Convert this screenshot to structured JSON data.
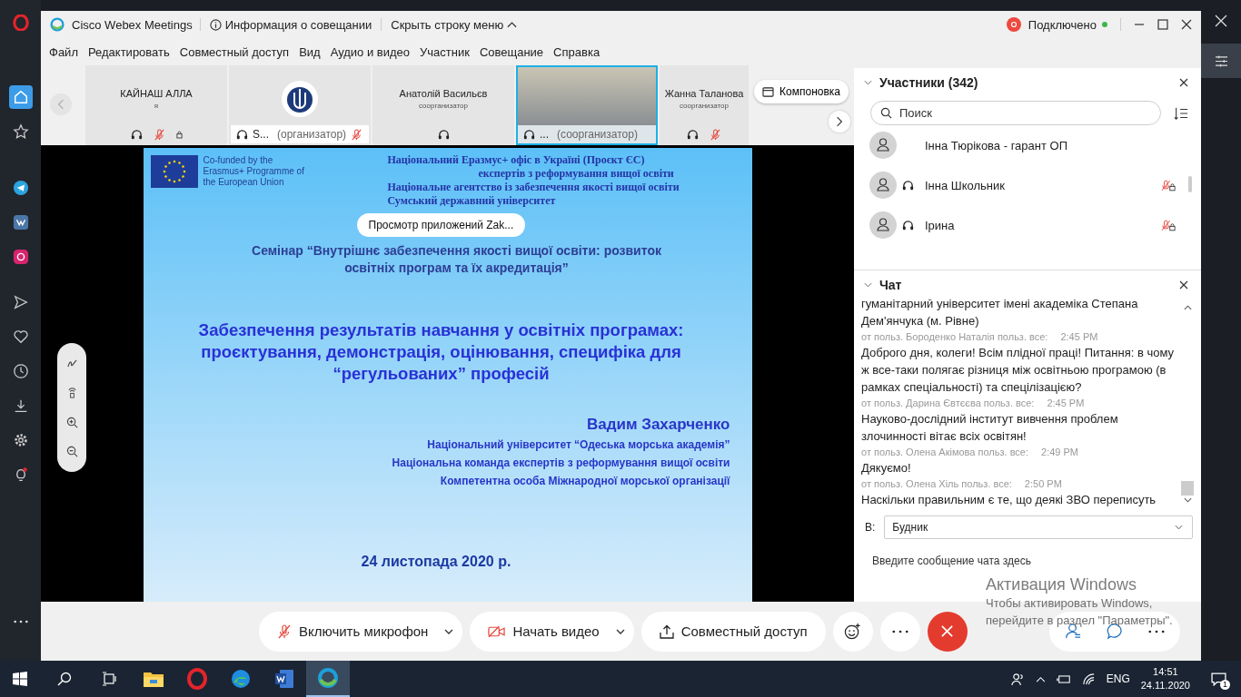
{
  "opera_sidebar": {
    "items": [
      {
        "kind": "home",
        "selected": true
      },
      {
        "kind": "star",
        "selected": false
      },
      {
        "kind": "telegram",
        "selected": false
      },
      {
        "kind": "vk",
        "selected": false
      },
      {
        "kind": "instagram",
        "selected": false
      },
      {
        "kind": "send",
        "selected": false
      },
      {
        "kind": "heart",
        "selected": false
      },
      {
        "kind": "history",
        "selected": false
      },
      {
        "kind": "download",
        "selected": false
      },
      {
        "kind": "settings",
        "selected": false
      },
      {
        "kind": "bulb",
        "selected": false
      }
    ]
  },
  "title_bar": {
    "app_name": "Cisco Webex Meetings",
    "info": "Информация о совещании",
    "hide_menu": "Скрыть строку меню",
    "status": "Подключено",
    "connected": true
  },
  "menu": [
    "Файл",
    "Редактировать",
    "Совместный доступ",
    "Вид",
    "Аудио и видео",
    "Участник",
    "Совещание",
    "Справка"
  ],
  "thumbnails": [
    {
      "kind": "name",
      "name": "КАЙНАШ АЛЛА",
      "role": "я",
      "audio": true,
      "muted": true,
      "locked": true,
      "selected": false
    },
    {
      "kind": "logo",
      "label": "S...",
      "role": "(организатор)",
      "audio": true,
      "muted": true,
      "locked": false,
      "selected": false
    },
    {
      "kind": "name",
      "name": "Анатолій Васильєв",
      "role": "соорганизатор",
      "audio": true,
      "muted": false,
      "locked": false,
      "selected": false
    },
    {
      "kind": "video",
      "label": "...",
      "role": "(соорганизатор)",
      "audio": true,
      "muted": false,
      "locked": false,
      "selected": true
    },
    {
      "kind": "name",
      "name": "Жанна Таланова",
      "role": "соорганизатор",
      "audio": true,
      "muted": true,
      "locked": false,
      "selected": false
    }
  ],
  "layout_button": "Компоновка",
  "slide": {
    "eu_text": "Co-funded by the Erasmus+ Programme of the European Union",
    "header_lines": [
      "Національний Еразмус+ офіс в Україні (Проєкт ЄС)",
      "експертів з реформування вищої освіти",
      "Національне агентство із забезпечення якості вищої освіти",
      "Сумський державний університет"
    ],
    "seminar": "Семінар  “Внутрішнє забезпечення якості вищої освіти: розвиток освітніх програм та їх акредитація”",
    "title": "Забезпечення результатів навчання у освітніх програмах: проєктування, демонстрація, оцінювання, специфіка для “регульованих” професій",
    "author": "Вадим Захарченко",
    "affiliations": [
      "Національний університет “Одеська морська академія”",
      "Національна команда експертів з реформування вищої освіти",
      "Компетентна особа Міжнародної морської організації"
    ],
    "date": "24 листопада 2020 р."
  },
  "tooltip": "Просмотр приложений Zak...",
  "participants": {
    "title": "Участники (342)",
    "search_placeholder": "Поиск",
    "items": [
      {
        "name": "Інна Тюрікова - гарант ОП",
        "audio": false,
        "muted": false
      },
      {
        "name": "Інна Школьник",
        "audio": true,
        "muted": true
      },
      {
        "name": "Ірина",
        "audio": true,
        "muted": true
      }
    ]
  },
  "chat": {
    "title": "Чат",
    "items": [
      {
        "kind": "text",
        "text": "гуманітарний університет імені академіка Степана Дем'янчука (м. Рівне)"
      },
      {
        "kind": "meta",
        "from": "от польз. Бороденко Наталія польз. все:",
        "time": "2:45 PM"
      },
      {
        "kind": "text",
        "text": "Доброго дня, колеги! Всім плідної праці! Питання: в чому ж все-таки полягає різниця між освітньою програмою (в рамках спеціальності) та спецілізацією?"
      },
      {
        "kind": "meta",
        "from": "от польз. Дарина Євтєєва польз. все:",
        "time": "2:45 PM"
      },
      {
        "kind": "text",
        "text": "Науково-дослідний інститут вивчення проблем злочинності вітає всіх освітян!"
      },
      {
        "kind": "meta",
        "from": "от польз. Олена Акімова польз. все:",
        "time": "2:49 PM"
      },
      {
        "kind": "text",
        "text": "Дякуємо!"
      },
      {
        "kind": "meta",
        "from": "от польз. Олена Хіль польз. все:",
        "time": "2:50 PM"
      },
      {
        "kind": "text",
        "text": "Наскільки правильним є те, що деякі ЗВО переписуть"
      }
    ],
    "to_label": "В:",
    "to_value": "Будник",
    "input_placeholder": "Введите сообщение чата здесь"
  },
  "toolbar": {
    "left": [
      {
        "kind": "mic",
        "label": "Включить микрофон",
        "dropdown": true
      },
      {
        "kind": "video",
        "label": "Начать видео",
        "dropdown": true
      },
      {
        "kind": "share",
        "label": "Совместный доступ",
        "dropdown": false
      },
      {
        "kind": "emoji"
      },
      {
        "kind": "more"
      },
      {
        "kind": "end"
      }
    ],
    "right": [
      {
        "kind": "participants"
      },
      {
        "kind": "chat"
      },
      {
        "kind": "more"
      }
    ]
  },
  "windows_activation": {
    "title": "Активация Windows",
    "text": "Чтобы активировать Windows, перейдите в раздел \"Параметры\"."
  },
  "taskbar": {
    "apps": [
      {
        "kind": "explorer",
        "selected": false
      },
      {
        "kind": "opera",
        "selected": false
      },
      {
        "kind": "edge",
        "selected": false
      },
      {
        "kind": "word",
        "selected": false
      },
      {
        "kind": "webex",
        "selected": true
      }
    ],
    "language": "ENG",
    "time": "14:51",
    "date": "24.11.2020",
    "notifications": "1"
  }
}
